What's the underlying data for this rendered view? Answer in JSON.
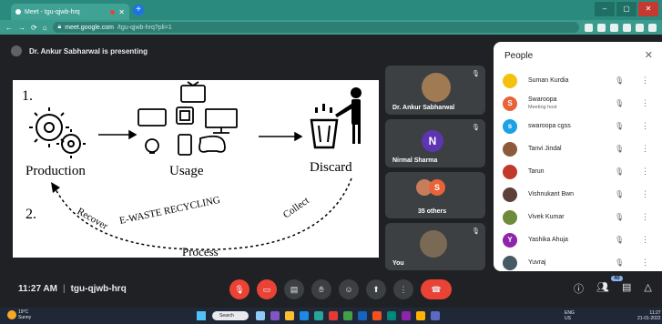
{
  "browser": {
    "tab_title": "Meet - tgu-qjwb-hrq",
    "url_host": "meet.google.com",
    "url_path": "/tgu-qjwb-hrq?pli=1"
  },
  "presenting": {
    "text": "Dr. Ankur Sabharwal is presenting"
  },
  "slide": {
    "step1": "1.",
    "step2": "2.",
    "production": "Production",
    "usage": "Usage",
    "discard": "Discard",
    "ewaste": "E-WASTE RECYCLING",
    "recover": "Recover",
    "collect": "Collect",
    "process": "Process"
  },
  "tiles": {
    "t1_name": "Dr. Ankur Sabharwal",
    "t2_initial": "N",
    "t2_name": "Nirmal Sharma",
    "t3_name": "35 others",
    "t3_initial": "S",
    "t4_name": "You"
  },
  "people": {
    "title": "People",
    "items": [
      {
        "name": "Suman Kurdia",
        "sub": "",
        "initial": "",
        "color": "#f4c20d"
      },
      {
        "name": "Swaroopa",
        "sub": "Meeting host",
        "initial": "S",
        "color": "#e8633a"
      },
      {
        "name": "swaroopa cgss",
        "sub": "",
        "initial": "s",
        "color": "#1aa1e6"
      },
      {
        "name": "Tanvi Jindal",
        "sub": "",
        "initial": "",
        "color": "#8d5a3b"
      },
      {
        "name": "Tarun",
        "sub": "",
        "initial": "",
        "color": "#c0392b"
      },
      {
        "name": "Vishnukant Bwn",
        "sub": "",
        "initial": "",
        "color": "#5d4037"
      },
      {
        "name": "Vivek Kumar",
        "sub": "",
        "initial": "",
        "color": "#6d8b3a"
      },
      {
        "name": "Yashika Ahuja",
        "sub": "",
        "initial": "Y",
        "color": "#8e24aa"
      },
      {
        "name": "Yuvraj",
        "sub": "",
        "initial": "",
        "color": "#455a64"
      }
    ]
  },
  "meeting": {
    "time": "11:27 AM",
    "code": "tgu-qjwb-hrq",
    "participants_count": "40"
  },
  "taskbar": {
    "weather_temp": "19°C",
    "weather_desc": "Sunny",
    "search": "Search",
    "lang": "ENG",
    "region": "US",
    "time": "11:27",
    "date": "21-01-2022"
  }
}
